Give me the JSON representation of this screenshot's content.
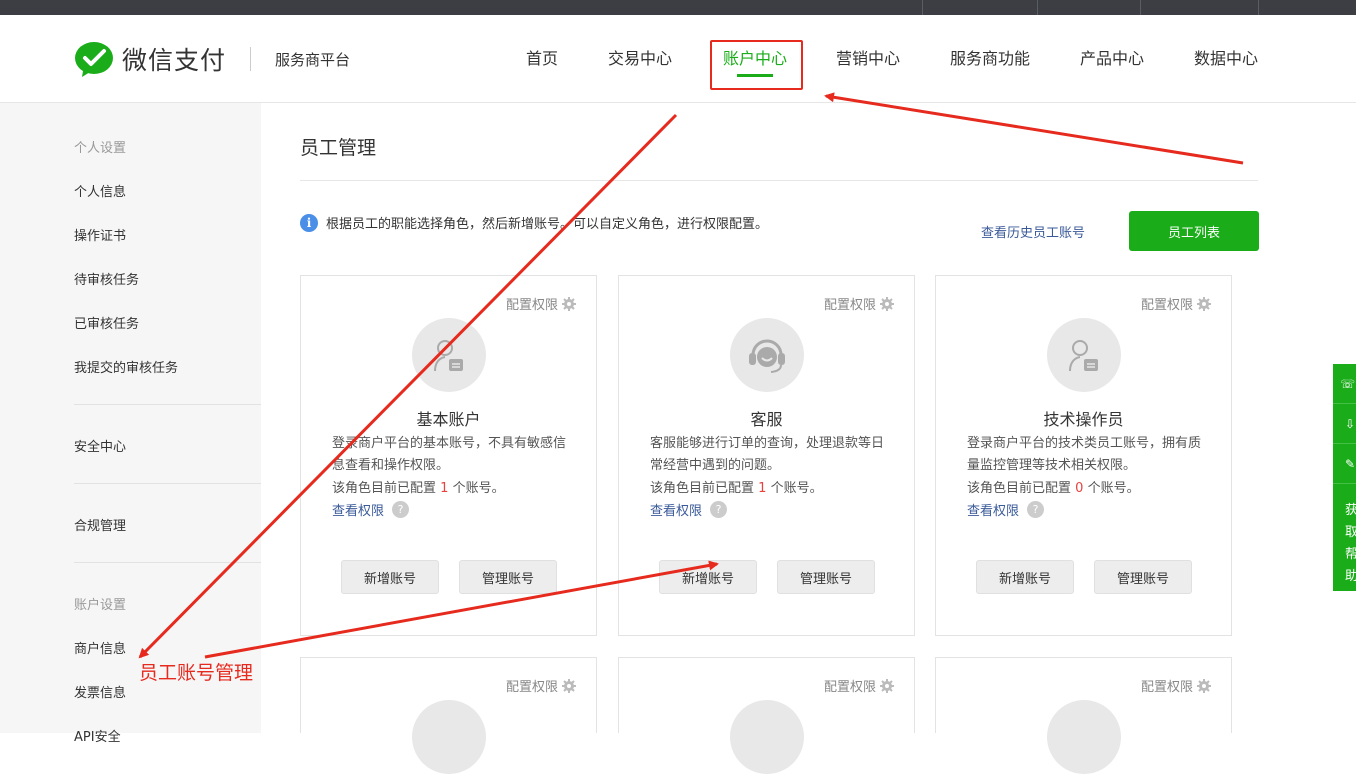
{
  "header": {
    "brand": "微信支付",
    "platform": "服务商平台",
    "nav": [
      "首页",
      "交易中心",
      "账户中心",
      "营销中心",
      "服务商功能",
      "产品中心",
      "数据中心"
    ],
    "active_nav": "账户中心"
  },
  "sidebar": {
    "personal_group": "个人设置",
    "personal_items": [
      "个人信息",
      "操作证书",
      "待审核任务",
      "已审核任务",
      "我提交的审核任务"
    ],
    "security": "安全中心",
    "compliance": "合规管理",
    "account_group": "账户设置",
    "account_items": [
      "商户信息",
      "发票信息",
      "API安全"
    ]
  },
  "main": {
    "title": "员工管理",
    "tip": "根据员工的职能选择角色，然后新增账号。可以自定义角色，进行权限配置。",
    "history_link": "查看历史员工账号",
    "list_button": "员工列表"
  },
  "cards": [
    {
      "config": "配置权限",
      "name": "基本账户",
      "desc": "登录商户平台的基本账号，不具有敏感信息查看和操作权限。",
      "count_prefix": "该角色目前已配置",
      "count": "1",
      "count_suffix": "个账号。",
      "view_perm": "查看权限",
      "add": "新增账号",
      "manage": "管理账号",
      "icon": "person-doc-icon"
    },
    {
      "config": "配置权限",
      "name": "客服",
      "desc": "客服能够进行订单的查询，处理退款等日常经营中遇到的问题。",
      "count_prefix": "该角色目前已配置",
      "count": "1",
      "count_suffix": "个账号。",
      "view_perm": "查看权限",
      "add": "新增账号",
      "manage": "管理账号",
      "icon": "headset-icon"
    },
    {
      "config": "配置权限",
      "name": "技术操作员",
      "desc": "登录商户平台的技术类员工账号，拥有质量监控管理等技术相关权限。",
      "count_prefix": "该角色目前已配置",
      "count": "0",
      "count_suffix": "个账号。",
      "view_perm": "查看权限",
      "add": "新增账号",
      "manage": "管理账号",
      "icon": "person-doc-icon"
    },
    {
      "config": "配置权限"
    },
    {
      "config": "配置权限"
    },
    {
      "config": "配置权限"
    }
  ],
  "floatbar": {
    "text": "获取帮助"
  },
  "annotation": {
    "label": "员工账号管理",
    "color": "#e62a1e"
  },
  "colors": {
    "accent": "#1aad19",
    "link": "#3a5a99",
    "annotation": "#e62a1e"
  }
}
